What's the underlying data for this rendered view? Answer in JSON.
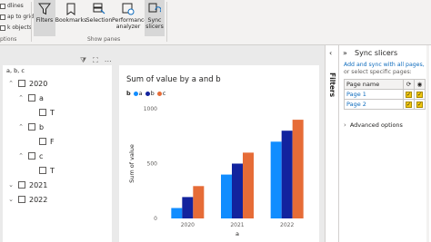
{
  "ribbon": {
    "left_items": [
      "dlines",
      "ap to grid",
      "k objects"
    ],
    "left_group_label": "ptions",
    "buttons": [
      {
        "id": "filters",
        "label": "Filters",
        "active": true
      },
      {
        "id": "bookmarks",
        "label": "Bookmarks",
        "active": false
      },
      {
        "id": "selection",
        "label": "Selection",
        "active": false
      },
      {
        "id": "performance",
        "label": "Performance analyzer",
        "active": false
      },
      {
        "id": "sync-slicers",
        "label": "Sync slicers",
        "active": true
      }
    ],
    "group_label": "Show panes"
  },
  "slicer": {
    "header": "a, b, c",
    "tree": [
      {
        "label": "2020",
        "level": 0,
        "expanded": true
      },
      {
        "label": "a",
        "level": 1,
        "expanded": true
      },
      {
        "label": "T",
        "level": 2,
        "expanded": null
      },
      {
        "label": "b",
        "level": 1,
        "expanded": true
      },
      {
        "label": "F",
        "level": 2,
        "expanded": null
      },
      {
        "label": "c",
        "level": 1,
        "expanded": true
      },
      {
        "label": "T",
        "level": 2,
        "expanded": null
      },
      {
        "label": "2021",
        "level": 0,
        "expanded": false
      },
      {
        "label": "2022",
        "level": 0,
        "expanded": false
      }
    ]
  },
  "chart_data": {
    "type": "bar",
    "title": "Sum of value by a and b",
    "xlabel": "a",
    "ylabel": "Sum of value",
    "categories": [
      "2020",
      "2021",
      "2022"
    ],
    "legend_title": "b",
    "series": [
      {
        "name": "a",
        "color": "#118dff",
        "values": [
          95,
          400,
          700
        ]
      },
      {
        "name": "b",
        "color": "#12239e",
        "values": [
          195,
          500,
          800
        ]
      },
      {
        "name": "c",
        "color": "#e66c37",
        "values": [
          295,
          600,
          900
        ]
      }
    ],
    "ylim": [
      0,
      1000
    ],
    "yticks": [
      0,
      500,
      1000
    ],
    "legend_position": "top-left",
    "grid": false
  },
  "filters_pane": {
    "label": "Filters"
  },
  "sync_pane": {
    "title": "Sync slicers",
    "info_line1": "Add and sync with all pages,",
    "info_line2": "or select specific pages:",
    "info_link": "Add and sync with all pages,",
    "column_header": "Page name",
    "pages": [
      {
        "name": "Page 1",
        "sync": true,
        "visible": true
      },
      {
        "name": "Page 2",
        "sync": true,
        "visible": true
      }
    ],
    "advanced_label": "Advanced options"
  }
}
